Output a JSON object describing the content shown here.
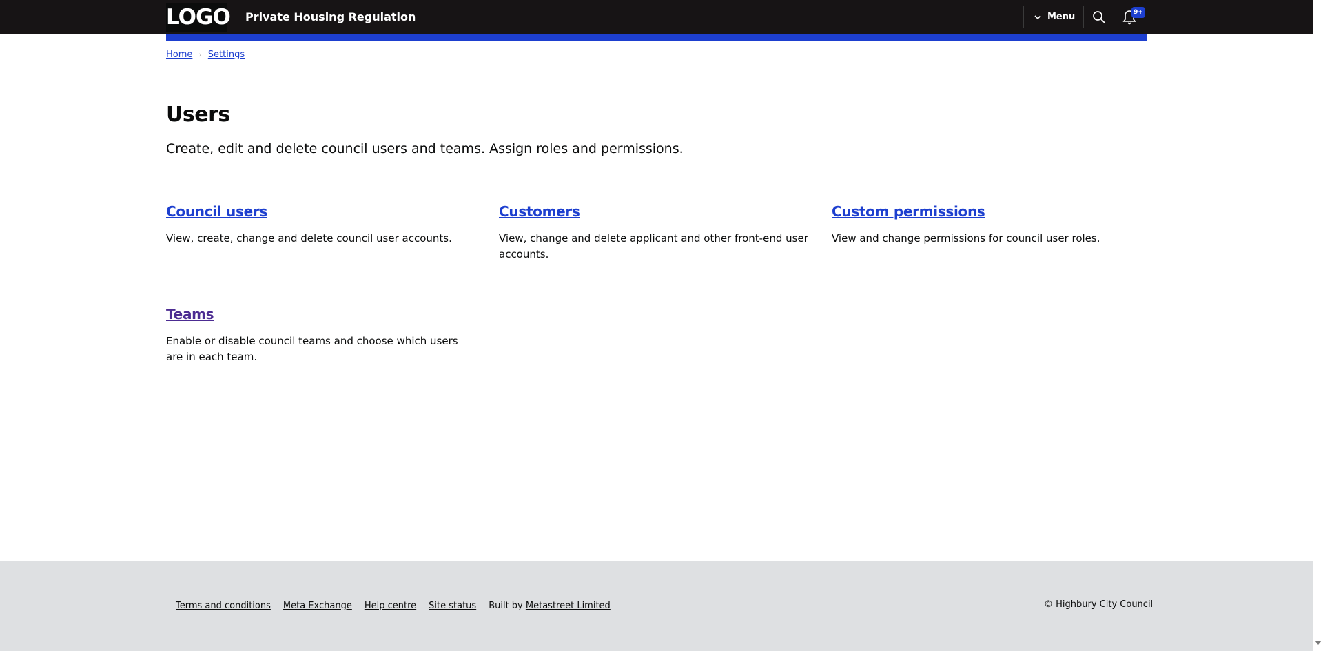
{
  "header": {
    "logo": "LOGO",
    "service_name": "Private Housing Regulation",
    "menu_label": "Menu",
    "notifications_badge": "9+"
  },
  "breadcrumb": [
    {
      "label": "Home"
    },
    {
      "label": "Settings"
    }
  ],
  "main": {
    "title": "Users",
    "lead": "Create, edit and delete council users and teams. Assign roles and permissions.",
    "cards": [
      {
        "title": "Council users",
        "description": "View, create, change and delete council user accounts."
      },
      {
        "title": "Customers",
        "description": "View, change and delete applicant and other front-end user accounts."
      },
      {
        "title": "Custom permissions",
        "description": "View and change permissions for council user roles."
      },
      {
        "title": "Teams",
        "description": "Enable or disable council teams and choose which users are in each team."
      }
    ]
  },
  "footer": {
    "links": [
      "Terms and conditions",
      "Meta Exchange",
      "Help centre",
      "Site status"
    ],
    "built_by_prefix": "Built by",
    "built_by_link": "Metastreet Limited",
    "copyright": "© Highbury City Council"
  },
  "colors": {
    "header_bg": "#171415",
    "accent_blue": "#1d3fcf",
    "visited_link": "#4c2c92",
    "footer_bg": "#dee0e2"
  }
}
